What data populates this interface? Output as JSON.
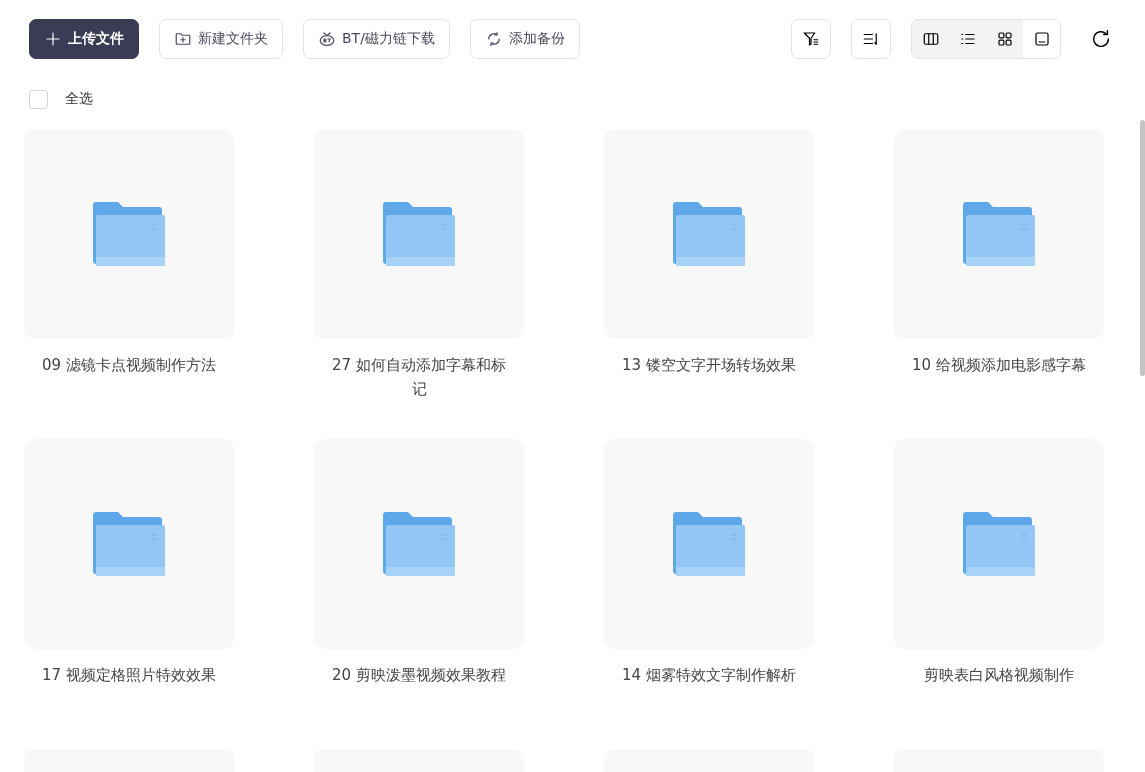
{
  "toolbar": {
    "actions": [
      {
        "kind": "primary",
        "label": "上传文件"
      },
      {
        "kind": "outline",
        "label": "新建文件夹"
      },
      {
        "kind": "outline",
        "label": "BT/磁力链下载"
      },
      {
        "kind": "outline",
        "label": "添加备份"
      }
    ],
    "view_modes": [
      {
        "selected": false
      },
      {
        "selected": false
      },
      {
        "selected": false
      },
      {
        "selected": true
      }
    ]
  },
  "select_all": {
    "label": "全选",
    "checked": false
  },
  "folders": [
    {
      "kind": "folder",
      "name": "09 滤镜卡点视频制作方法"
    },
    {
      "kind": "folder",
      "name": "27 如何自动添加字幕和标记"
    },
    {
      "kind": "folder",
      "name": "13 镂空文字开场转场效果"
    },
    {
      "kind": "folder",
      "name": "10 给视频添加电影感字幕"
    },
    {
      "kind": "folder",
      "name": "17 视频定格照片特效效果"
    },
    {
      "kind": "folder",
      "name": "20 剪映泼墨视频效果教程"
    },
    {
      "kind": "folder",
      "name": "14 烟雾特效文字制作解析"
    },
    {
      "kind": "folder",
      "name": "剪映表白风格视频制作"
    },
    {
      "kind": "folder"
    },
    {
      "kind": "folder"
    },
    {
      "kind": "folder"
    },
    {
      "kind": "folder"
    }
  ]
}
